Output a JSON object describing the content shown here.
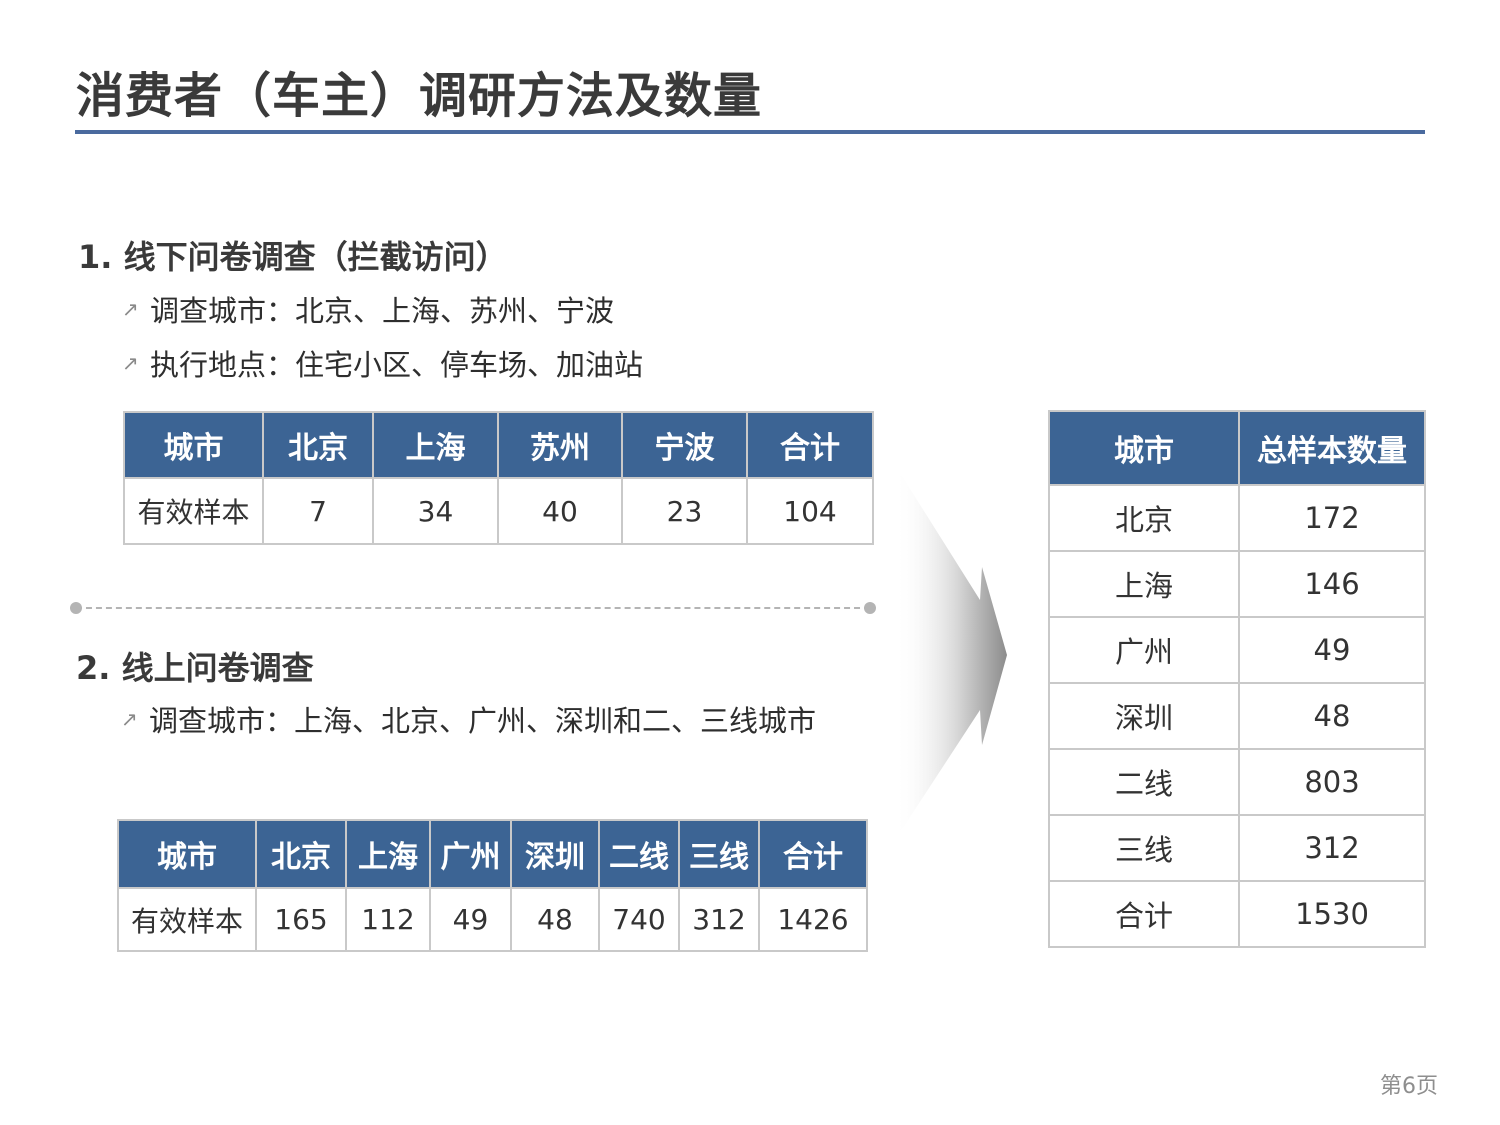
{
  "title": "消费者（车主）调研方法及数量",
  "section1": {
    "heading": "1. 线下问卷调查（拦截访问）",
    "bullets": [
      "调查城市：北京、上海、苏州、宁波",
      "执行地点：住宅小区、停车场、加油站"
    ],
    "table": {
      "headers": [
        "城市",
        "北京",
        "上海",
        "苏州",
        "宁波",
        "合计"
      ],
      "row": [
        "有效样本",
        "7",
        "34",
        "40",
        "23",
        "104"
      ]
    }
  },
  "section2": {
    "heading": "2. 线上问卷调查",
    "bullets": [
      "调查城市：上海、北京、广州、深圳和二、三线城市"
    ],
    "table": {
      "headers": [
        "城市",
        "北京",
        "上海",
        "广州",
        "深圳",
        "二线",
        "三线",
        "合计"
      ],
      "row": [
        "有效样本",
        "165",
        "112",
        "49",
        "48",
        "740",
        "312",
        "1426"
      ]
    }
  },
  "summary_table": {
    "headers": [
      "城市",
      "总样本数量"
    ],
    "rows": [
      [
        "北京",
        "172"
      ],
      [
        "上海",
        "146"
      ],
      [
        "广州",
        "49"
      ],
      [
        "深圳",
        "48"
      ],
      [
        "二线",
        "803"
      ],
      [
        "三线",
        "312"
      ],
      [
        "合计",
        "1530"
      ]
    ]
  },
  "page_number": "第6页",
  "colors": {
    "header_bg": "#3c6494",
    "title_rule": "#4a6a9e",
    "border": "#c9c9c9"
  },
  "icons": {
    "bullet": "arrow-up-right-icon",
    "flow": "chevron-right-arrow"
  }
}
